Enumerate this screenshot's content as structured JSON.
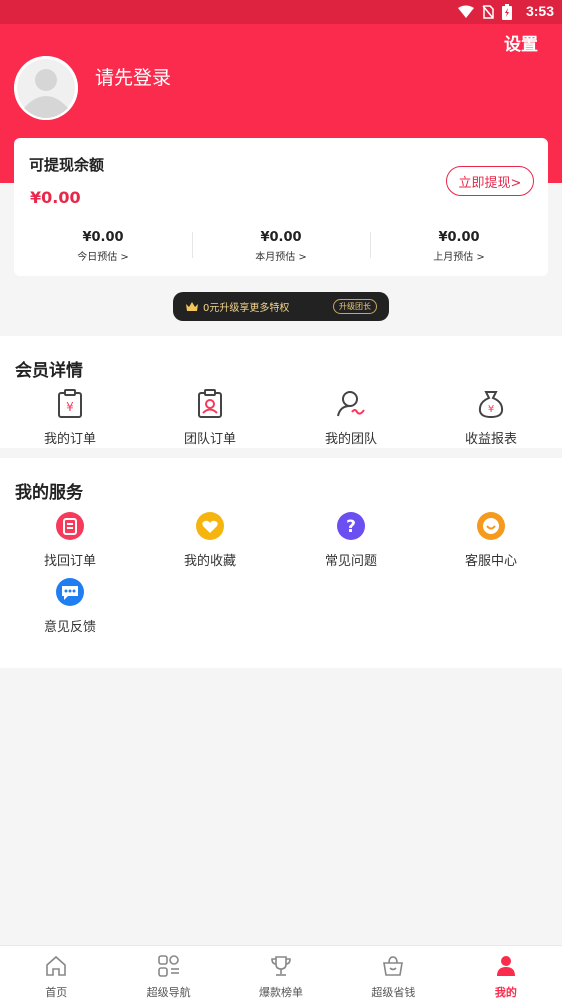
{
  "status_bar": {
    "time": "3:53"
  },
  "header": {
    "settings_label": "设置",
    "login_prompt": "请先登录"
  },
  "balance": {
    "title": "可提现余额",
    "value": "¥0.00",
    "withdraw_label": "立即提现>",
    "estimates": [
      {
        "value": "¥0.00",
        "label": "今日预估 >"
      },
      {
        "value": "¥0.00",
        "label": "本月预估 >"
      },
      {
        "value": "¥0.00",
        "label": "上月预估 >"
      }
    ]
  },
  "upgrade": {
    "text": "0元升级享更多特权",
    "pill": "升级团长"
  },
  "member": {
    "title": "会员详情",
    "items": [
      {
        "label": "我的订单",
        "icon": "order-icon"
      },
      {
        "label": "团队订单",
        "icon": "team-order-icon"
      },
      {
        "label": "我的团队",
        "icon": "team-icon"
      },
      {
        "label": "收益报表",
        "icon": "money-bag-icon"
      }
    ]
  },
  "services": {
    "title": "我的服务",
    "items": [
      {
        "label": "找回订单",
        "icon": "retrieve-order-icon",
        "color": "#f53a5c"
      },
      {
        "label": "我的收藏",
        "icon": "heart-icon",
        "color": "#f6b40e"
      },
      {
        "label": "常见问题",
        "icon": "question-icon",
        "color": "#6b4ff0"
      },
      {
        "label": "客服中心",
        "icon": "customer-service-icon",
        "color": "#f59a1c"
      },
      {
        "label": "意见反馈",
        "icon": "chat-icon",
        "color": "#1f7ff0"
      }
    ]
  },
  "tabbar": {
    "items": [
      {
        "label": "首页",
        "icon": "home-icon"
      },
      {
        "label": "超级导航",
        "icon": "grid-icon"
      },
      {
        "label": "爆款榜单",
        "icon": "trophy-icon"
      },
      {
        "label": "超级省钱",
        "icon": "basket-icon"
      },
      {
        "label": "我的",
        "icon": "user-icon"
      }
    ],
    "active_index": 4
  },
  "colors": {
    "primary": "#fa2b4c",
    "status_bar": "#dd2340",
    "background": "#f5f5f5"
  }
}
